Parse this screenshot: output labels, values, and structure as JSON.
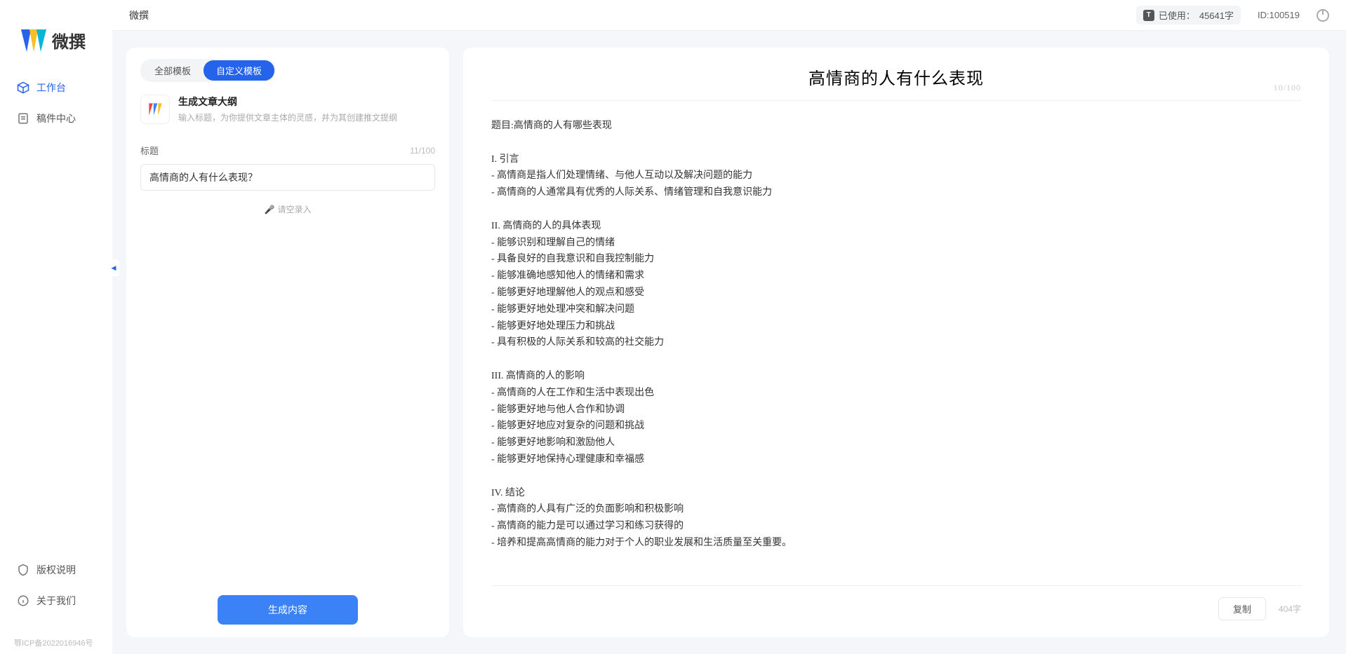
{
  "app": {
    "name": "微撰",
    "logo_text": "微撰"
  },
  "sidebar": {
    "nav": [
      {
        "label": "工作台",
        "active": true
      },
      {
        "label": "稿件中心",
        "active": false
      }
    ],
    "bottom": [
      {
        "label": "版权说明"
      },
      {
        "label": "关于我们"
      }
    ],
    "icp": "鄂ICP备2022016946号"
  },
  "topbar": {
    "title": "微撰",
    "usage_label": "已使用：",
    "usage_value": "45641字",
    "user_id": "ID:100519"
  },
  "left": {
    "tabs": [
      {
        "label": "全部模板",
        "active": false
      },
      {
        "label": "自定义模板",
        "active": true
      }
    ],
    "template": {
      "title": "生成文章大纲",
      "desc": "输入标题，为你提供文章主体的灵感，并为其创建推文提纲"
    },
    "title_field": {
      "label": "标题",
      "counter": "11/100",
      "value": "高情商的人有什么表现？"
    },
    "voice_hint": "请空录入",
    "generate_button": "生成内容"
  },
  "output": {
    "title": "高情商的人有什么表现",
    "title_counter": "10/100",
    "body": "题目:高情商的人有哪些表现\n\nI. 引言\n- 高情商是指人们处理情绪、与他人互动以及解决问题的能力\n- 高情商的人通常具有优秀的人际关系、情绪管理和自我意识能力\n\nII. 高情商的人的具体表现\n- 能够识别和理解自己的情绪\n- 具备良好的自我意识和自我控制能力\n- 能够准确地感知他人的情绪和需求\n- 能够更好地理解他人的观点和感受\n- 能够更好地处理冲突和解决问题\n- 能够更好地处理压力和挑战\n- 具有积极的人际关系和较高的社交能力\n\nIII. 高情商的人的影响\n- 高情商的人在工作和生活中表现出色\n- 能够更好地与他人合作和协调\n- 能够更好地应对复杂的问题和挑战\n- 能够更好地影响和激励他人\n- 能够更好地保持心理健康和幸福感\n\nIV. 结论\n- 高情商的人具有广泛的负面影响和积极影响\n- 高情商的能力是可以通过学习和练习获得的\n- 培养和提高高情商的能力对于个人的职业发展和生活质量至关重要。",
    "copy_button": "复制",
    "word_count": "404字"
  }
}
